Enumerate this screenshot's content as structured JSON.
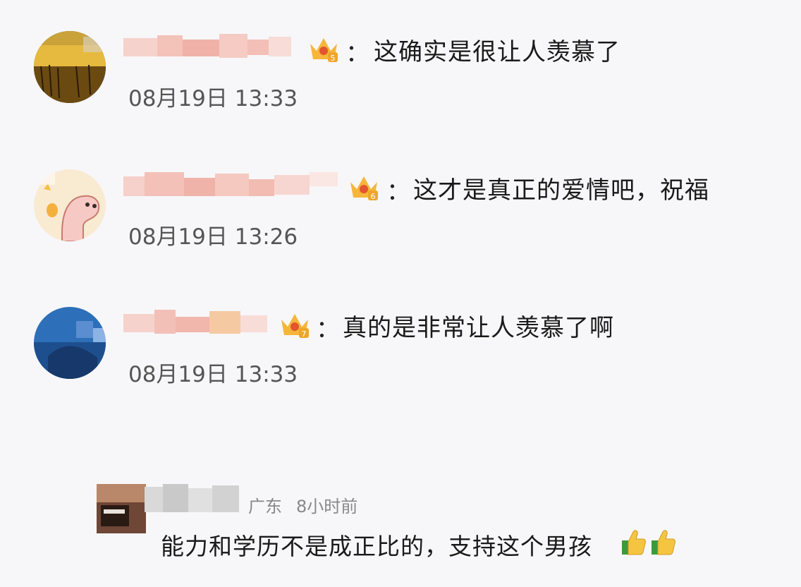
{
  "comments": [
    {
      "text": "这确实是很让人羡慕了",
      "time": "08月19日 13:33",
      "level_badge": "crown-level-icon",
      "level": "5",
      "colon": "："
    },
    {
      "text": "这才是真正的爱情吧，祝福",
      "time": "08月19日 13:26",
      "level_badge": "crown-level-icon",
      "level": "6",
      "colon": "："
    },
    {
      "text": "真的是非常让人羡慕了啊",
      "time": "08月19日 13:33",
      "level_badge": "crown-level-icon",
      "level": "7",
      "colon": "："
    }
  ],
  "reply": {
    "location": "广东",
    "time_ago": "8小时前",
    "text": "能力和学历不是成正比的，支持这个男孩",
    "emojis": [
      "thumbs-up-icon",
      "thumbs-up-icon"
    ]
  },
  "colors": {
    "background": "#f7f7f9",
    "text": "#1a1a1a",
    "time": "#555555",
    "mosaic": "#f2b8b0",
    "crown": "#f5b63a"
  }
}
